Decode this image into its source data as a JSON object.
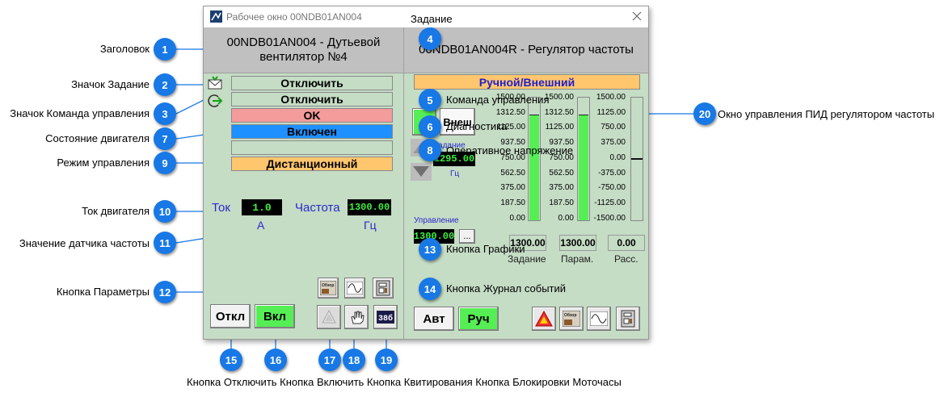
{
  "window": {
    "title": "Рабочее окно 00NDB01AN004",
    "left_header": "00NDB01AN004 - Дутьевой вентилятор №4",
    "right_header": "00NDB01AN004R - Регулятор частоты"
  },
  "left_panel": {
    "bars": {
      "command1": "Отключить",
      "command2": "Отключить",
      "state_ok": "OK",
      "motor_state": "Включен",
      "empty": "",
      "mode": "Дистанционный"
    },
    "current_label": "Ток",
    "current_value": "1.0",
    "current_unit": "А",
    "freq_label": "Частота",
    "freq_value": "1300.00",
    "freq_unit": "Гц",
    "btn_off": "Откл",
    "btn_on": "Вкл",
    "icon_obzor": "Обзор",
    "icon_clock_text": "38б"
  },
  "right_panel": {
    "mode_bar": "Ручной/Внешний",
    "btn_vnesh": "Внеш",
    "btn_green": "Д",
    "setpoint_label": "Задание",
    "setpoint_value": "1295.00",
    "setpoint_unit": "Гц",
    "control_label": "Управление",
    "control_value": "1300.00",
    "more_btn": "...",
    "scale1": [
      "1500.00",
      "1312.50",
      "1125.00",
      "937.50",
      "750.00",
      "562.50",
      "375.00",
      "187.50",
      "0.00"
    ],
    "scale2": [
      "1500.00",
      "1312.50",
      "1125.00",
      "937.50",
      "750.00",
      "562.50",
      "375.00",
      "187.50",
      "0.00"
    ],
    "scale3": [
      "1500.00",
      "1125.00",
      "750.00",
      "375.00",
      "0.00",
      "-375.00",
      "-750.00",
      "-1125.00",
      "-1500.00"
    ],
    "bar1_level": 0.87,
    "bar2_level": 0.87,
    "box_values": [
      "1300.00",
      "1300.00",
      "0.00"
    ],
    "box_captions": [
      "Задание",
      "Парам.",
      "Расс."
    ],
    "btn_auto": "Авт",
    "btn_manual": "Руч",
    "icon_obzor": "Обзор"
  },
  "annotations": {
    "a1": "Заголовок",
    "a2": "Значок Задание",
    "a3": "Значок Команда управления",
    "a7": "Состояние двигателя",
    "a9": "Режим управления",
    "a10": "Ток двигателя",
    "a11": "Значение датчика частоты",
    "a12": "Кнопка Параметры",
    "top_label": "Задание",
    "a5": "Команда управления",
    "a6": "Диагностика",
    "a8": "Оперативное напряжение",
    "a13": "Кнопка Графики",
    "a14": "Кнопка Журнал событий",
    "a20": "Окно управления ПИД регулятором частоты",
    "bottom": "Кнопка Отключить Кнопка Включить Кнопка Квитирования Кнопка Блокировки Моточасы"
  },
  "badges": [
    "1",
    "2",
    "3",
    "5",
    "6",
    "7",
    "8",
    "9",
    "10",
    "11",
    "12",
    "13",
    "14",
    "15",
    "16",
    "17",
    "18",
    "19",
    "20",
    "4"
  ],
  "colors": {
    "badge": "#1778e6",
    "panel": "#c5dcc5",
    "accent_green": "#55ee55",
    "orange": "#ffc66e",
    "blue_state": "#1e90ff",
    "red_state": "#f49b9b"
  }
}
